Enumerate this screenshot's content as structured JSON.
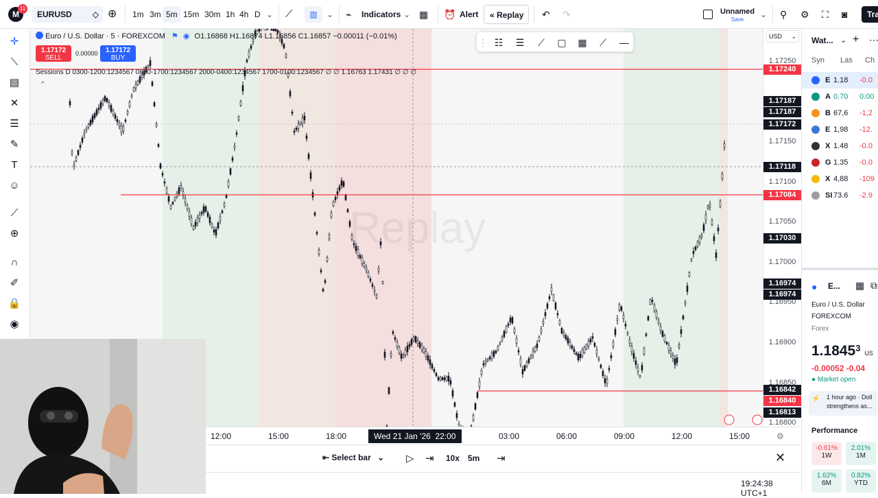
{
  "topbar": {
    "logo_letter": "M",
    "logo_badge": "11",
    "symbol": "EURUSD",
    "timeframes": [
      "1m",
      "3m",
      "5m",
      "15m",
      "30m",
      "1h",
      "4h",
      "D"
    ],
    "active_timeframe": "5m",
    "indicators": "Indicators",
    "alert": "Alert",
    "replay": "Replay",
    "layout_name": "Unnamed",
    "layout_status": "Save",
    "trade": "Tra"
  },
  "legend": {
    "title": "Euro / U.S. Dollar · 5 · FOREXCOM",
    "ohlc": "O1.16868 H1.16874 L1.16856 C1.16857 −0.00011 (−0.01%)",
    "sell_price": "1.17172",
    "sell_label": "SELL",
    "spread": "0.00000",
    "buy_price": "1.17172",
    "buy_label": "BUY",
    "sessions": "Sessions D 0300-1200:1234567 0800-1700:1234567 2000-0400:1234567 1700-0100:1234567 ∅ ∅ 1.16763 1.17431 ∅ ∅ ∅",
    "watermark": "Replay"
  },
  "price_scale": {
    "currency": "USD",
    "ticks": [
      "1.17250",
      "1.17150",
      "1.17100",
      "1.17050",
      "1.17000",
      "1.16950",
      "1.16900",
      "1.16850",
      "1.16800"
    ],
    "labels": [
      {
        "text": "1.17240",
        "style": "red"
      },
      {
        "text": "1.17187",
        "style": "blk"
      },
      {
        "text": "1.17187",
        "style": "blk"
      },
      {
        "text": "1.17172",
        "style": "blk"
      },
      {
        "text": "1.17118",
        "style": "blk"
      },
      {
        "text": "1.17084",
        "style": "red"
      },
      {
        "text": "1.17030",
        "style": "blk"
      },
      {
        "text": "1.16974",
        "style": "blk"
      },
      {
        "text": "1.16974",
        "style": "blk"
      },
      {
        "text": "1.16842",
        "style": "blk"
      },
      {
        "text": "1.16840",
        "style": "red"
      },
      {
        "text": "1.16813",
        "style": "blk"
      }
    ]
  },
  "chart_data": {
    "type": "candlestick",
    "horizontal_levels": [
      1.1724,
      1.17084,
      1.1684
    ],
    "x": [
      "12:00",
      "15:00",
      "18:00",
      "Wed 21 Jan '26",
      "22:00",
      "03:00",
      "06:00",
      "09:00",
      "12:00",
      "15:00"
    ],
    "y_range": [
      1.1679,
      1.1728
    ]
  },
  "time_axis": {
    "labels": [
      "12:00",
      "15:00",
      "18:00",
      "03:00",
      "06:00",
      "09:00",
      "12:00",
      "15:00"
    ],
    "crosshair": "Wed 21 Jan '26  22:00"
  },
  "replay_bar": {
    "select_bar": "Select bar",
    "speed": "10x",
    "interval": "5m"
  },
  "status": {
    "clock": "19:24:38 UTC+1"
  },
  "watchlist": {
    "title": "Wat...",
    "cols": [
      "Syn",
      "Las",
      "Ch"
    ],
    "rows": [
      {
        "sym": "E",
        "last": "1.18",
        "chg": "-0.0",
        "neg": true
      },
      {
        "sym": "A",
        "last": "0.70",
        "chg": "0.00",
        "neg": false
      },
      {
        "sym": "B",
        "last": "67,6",
        "chg": "-1,2",
        "neg": true
      },
      {
        "sym": "E",
        "last": "1,98",
        "chg": "-12.",
        "neg": true
      },
      {
        "sym": "X",
        "last": "1.48",
        "chg": "-0.0",
        "neg": true
      },
      {
        "sym": "G",
        "last": "1.35",
        "chg": "-0.0",
        "neg": true
      },
      {
        "sym": "X",
        "last": "4,88",
        "chg": "-109",
        "neg": true
      },
      {
        "sym": "SI",
        "last": "73.6",
        "chg": "-2.9",
        "neg": true
      }
    ],
    "detail": {
      "sym": "E...",
      "name": "Euro / U.S. Dollar",
      "exchange": "FOREXCOM",
      "type": "Forex",
      "price": "1.1845",
      "price_sup": "3",
      "currency": "US",
      "change": "-0.00052",
      "change_pct": "-0.04",
      "market": "Market open",
      "news_time": "1 hour ago · Doll",
      "news_text": "strengthens as..."
    },
    "performance": {
      "title": "Performance",
      "items": [
        {
          "val": "-0.61%",
          "lbl": "1W",
          "neg": true
        },
        {
          "val": "2.01%",
          "lbl": "1M",
          "neg": false
        },
        {
          "val": "1.62%",
          "lbl": "6M",
          "neg": false
        },
        {
          "val": "0.82%",
          "lbl": "YTD",
          "neg": false
        }
      ]
    }
  },
  "colors": {
    "red": "#f23645",
    "green": "#089981",
    "blue": "#2962ff",
    "dark": "#131722"
  }
}
